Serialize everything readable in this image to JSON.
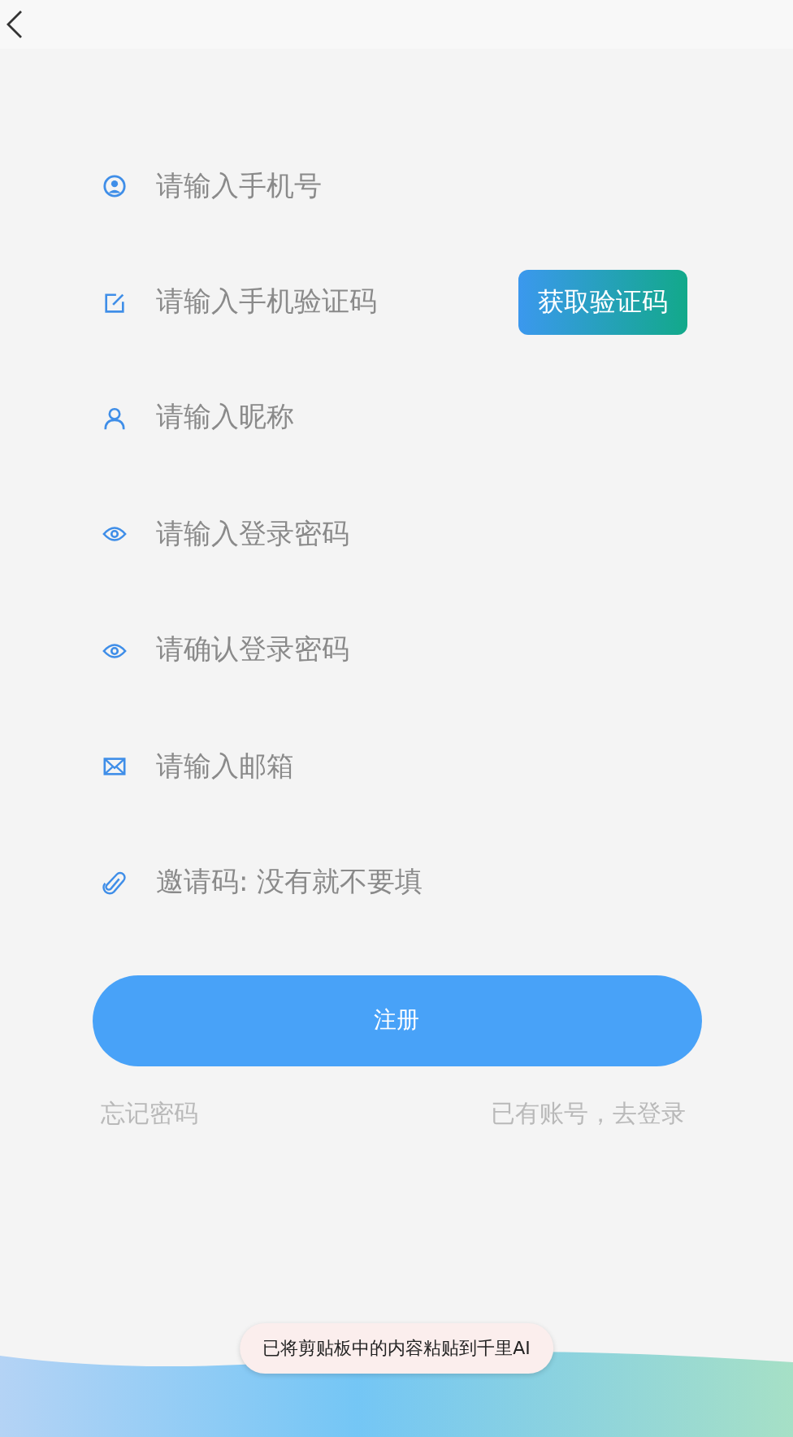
{
  "fields": [
    {
      "placeholder": "请输入手机号"
    },
    {
      "placeholder": "请输入手机验证码",
      "action": "获取验证码"
    },
    {
      "placeholder": "请输入昵称"
    },
    {
      "placeholder": "请输入登录密码"
    },
    {
      "placeholder": "请确认登录密码"
    },
    {
      "placeholder": "请输入邮箱"
    },
    {
      "placeholder": "邀请码: 没有就不要填"
    }
  ],
  "submit": "注册",
  "links": {
    "forgot": "忘记密码",
    "login": "已有账号，去登录"
  },
  "toast": "已将剪贴板中的内容粘贴到千里AI"
}
